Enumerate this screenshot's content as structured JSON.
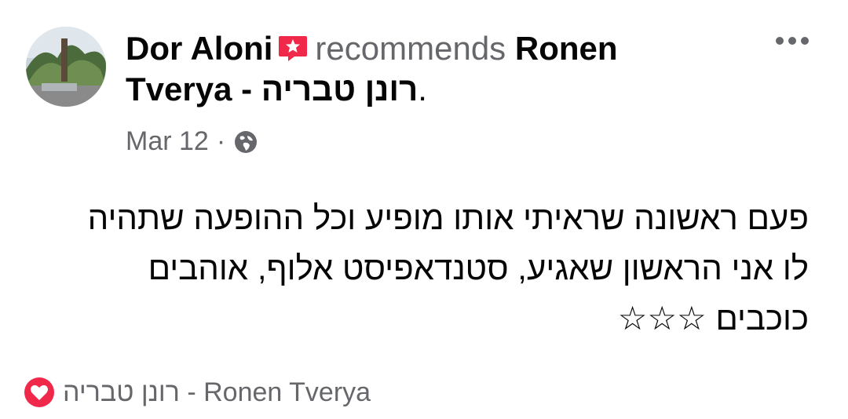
{
  "post": {
    "author": "Dor Aloni",
    "verb": "recommends",
    "page_name": "Ronen Tverya - רונן טבריה",
    "punct": ".",
    "date": "Mar 12",
    "separator": "·",
    "privacy_icon": "globe-icon",
    "recommend_icon": "recommend-star-badge-icon",
    "more_icon": "more-options-icon",
    "text": "פעם ראשונה שראיתי אותו מופיע וכל ההופעה שתהיה\nלו אני הראשון שאגיע, סטנדאפיסט אלוף, אוהבים\nכוכבים ☆☆☆",
    "footer_page": "רונן טבריה - Ronen Tverya",
    "footer_icon": "recommendation-heart-icon"
  },
  "colors": {
    "primary_text": "#050505",
    "secondary_text": "#65676b",
    "recommend_red": "#f02849"
  }
}
